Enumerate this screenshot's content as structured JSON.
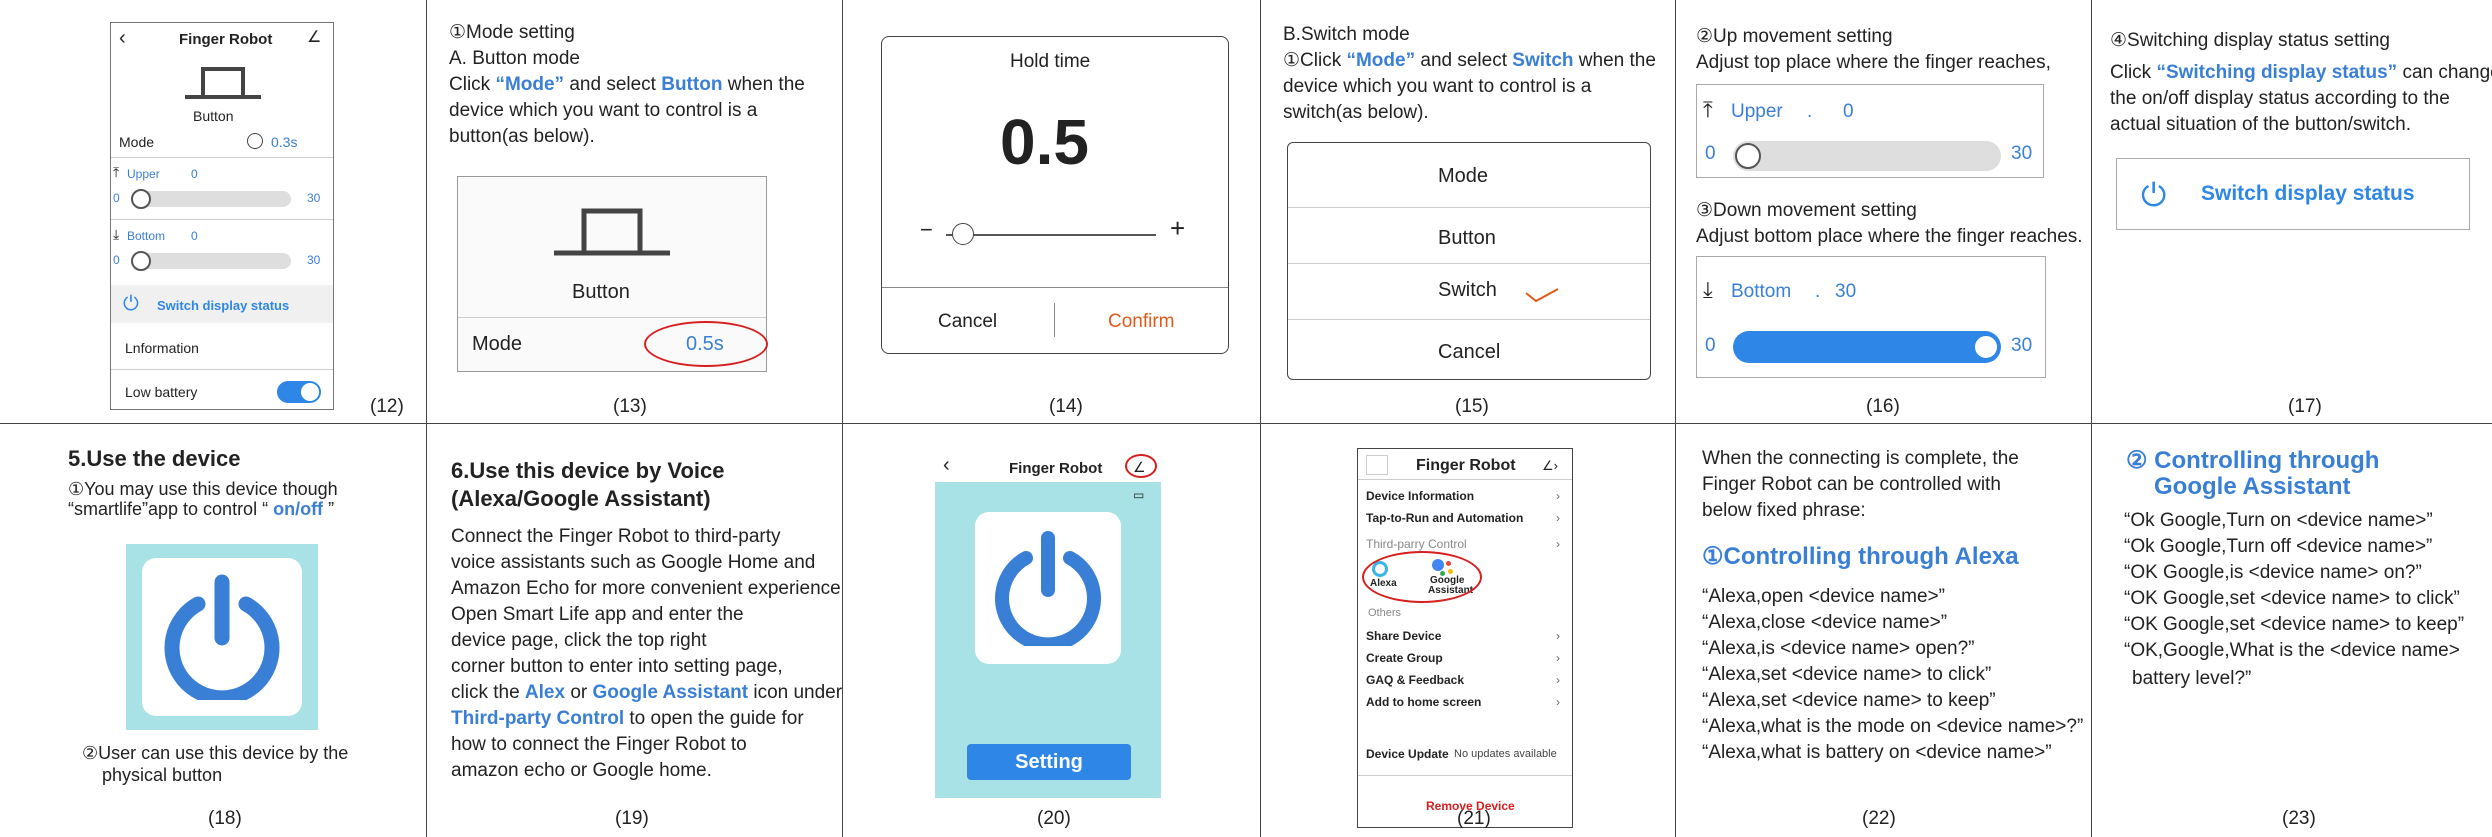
{
  "colors": {
    "accent": "#3a7fd6",
    "toggle": "#2e86e6",
    "confirm": "#e05a1a",
    "teal": "#a8e2e6",
    "red": "#d62020"
  },
  "c12": {
    "title": "Finger Robot",
    "back": "‹",
    "edit": "∠",
    "button_label": "Button",
    "mode_label": "Mode",
    "mode_value": "0.3s",
    "upper_label": "Upper",
    "upper_value": "0",
    "upper_min": "0",
    "upper_max": "30",
    "bottom_label": "Bottom",
    "bottom_value": "0",
    "bottom_min": "0",
    "bottom_max": "30",
    "switch_status": "Switch display status",
    "information": "Lnformation",
    "low_battery": "Low battery",
    "num": "(12)"
  },
  "c13": {
    "line1": "①Mode setting",
    "line2": "A. Button mode",
    "line3a": "Click ",
    "line3b": "“Mode”",
    "line3c": " and select ",
    "line3d": "Button",
    "line3e": " when the",
    "line4": "device which you want to control is a",
    "line5": "button(as below).",
    "button_label": "Button",
    "mode_label": "Mode",
    "mode_value": "0.5s",
    "num": "(13)"
  },
  "c14": {
    "title": "Hold time",
    "value": "0.5",
    "minus": "−",
    "plus": "+",
    "slider_level": 0.1,
    "cancel": "Cancel",
    "confirm": "Confirm",
    "num": "(14)"
  },
  "c15": {
    "line1": "B.Switch mode",
    "line2a": "①Click ",
    "line2b": "“Mode”",
    "line2c": " and select ",
    "line2d": "Switch",
    "line2e": " when the",
    "line3": "device which you want to control is a",
    "line4": "switch(as below).",
    "opt_mode": "Mode",
    "opt_button": "Button",
    "opt_switch": "Switch",
    "opt_cancel": "Cancel",
    "num": "(15)"
  },
  "c16": {
    "line1": "②Up movement setting",
    "line2": "Adjust top place where the finger reaches,",
    "upper_label": "Upper",
    "upper_dot": ".",
    "upper_value": "0",
    "upper_min": "0",
    "upper_max": "30",
    "line3": "③Down movement setting",
    "line4": "Adjust bottom place where the  finger reaches.",
    "bottom_label": "Bottom",
    "bottom_dot": ".",
    "bottom_value": "30",
    "bottom_min": "0",
    "bottom_max": "30",
    "num": "(16)"
  },
  "c17": {
    "line1": "④Switching display status setting",
    "line2a": "Click ",
    "line2b": "“Switching display status”",
    "line2c": " can change",
    "line3": "the on/off display status according to the",
    "line4": "actual situation of the button/switch.",
    "status": "Switch display status",
    "num": "(17)"
  },
  "c18": {
    "title": "5.Use the device",
    "line1": "①You may use this  device though",
    "line2a": "“smartlife”app to control “ ",
    "line2b": "on/off",
    "line2c": " ”",
    "line3": "②User can use this device by the",
    "line4": "physical button",
    "num": "(18)"
  },
  "c19": {
    "title1": "6.Use this device by Voice",
    "title2": "(Alexa/Google Assistant)",
    "lines": [
      "Connect the Finger Robot to third-party",
      "voice assistants such as Google Home and",
      "Amazon Echo for more convenient experience.",
      "Open Smart Life app and enter the",
      "device  page, click the top right",
      "corner button to enter into setting page,"
    ],
    "l7a": "click the ",
    "l7b": "Alex",
    "l7c": " or ",
    "l7d": "Google Assistant",
    "l7e": " icon under",
    "l8a": "Third-party Control",
    "l8b": " to open the guide for",
    "l9": "how to connect the Finger Robot to",
    "l10": "amazon echo or Google home.",
    "num": "(19)"
  },
  "c20": {
    "title": "Finger Robot",
    "back": "‹",
    "setting": "Setting",
    "num": "(20)"
  },
  "c21": {
    "title": "Finger Robot",
    "items1": [
      "Device Information",
      "Tap-to-Run and Automation"
    ],
    "third": "Third-parry Control",
    "alexa": "Alexa",
    "google1": "Google",
    "google2": "Assistant",
    "others": "Others",
    "items2": [
      "Share Device",
      "Create Group",
      "GAQ & Feedback",
      "Add to home screen"
    ],
    "update_label": "Device Update",
    "update_value": "No  updates available",
    "remove": "Remove Device",
    "num": "(21)"
  },
  "c22": {
    "line1": "When the connecting is complete, the",
    "line2": "Finger Robot can be controlled with",
    "line3": "below fixed phrase:",
    "heading": "①Controlling through Alexa",
    "phrases": [
      "“Alexa,open <device name>”",
      "“Alexa,close <device name>”",
      "“Alexa,is <device name> open?”",
      "“Alexa,set <device name> to click”",
      "“Alexa,set <device name> to keep”",
      "“Alexa,what is the mode on <device name>?”",
      "“Alexa,what is battery on <device name>”"
    ],
    "num": "(22)"
  },
  "c23": {
    "heading1": "② Controlling through",
    "heading2": "Google Assistant",
    "phrases": [
      "“Ok Google,Turn on <device name>”",
      "“Ok Google,Turn off <device name>”",
      "“OK Google,is <device name> on?”",
      "“OK Google,set <device name> to click”",
      "“OK Google,set <device name> to keep”",
      "“OK,Google,What is the <device name>"
    ],
    "last": "battery level?”",
    "num": "(23)"
  }
}
